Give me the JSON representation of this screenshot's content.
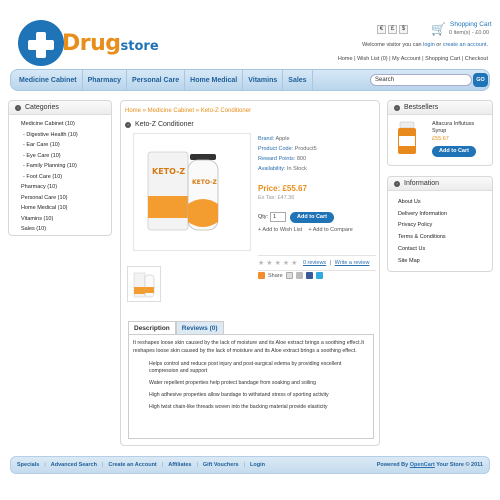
{
  "brand": {
    "drug": "Drug",
    "store": "store"
  },
  "currency": {
    "buttons": [
      "€",
      "£",
      "$"
    ]
  },
  "cart": {
    "title": "Shopping Cart",
    "summary": "0 item(s) - £0.00"
  },
  "welcome": {
    "prefix": "Welcome visitor you can ",
    "login": "login",
    "middle": " or ",
    "create": "create an account",
    "suffix": "."
  },
  "toplinks": [
    "Home",
    "Wish List (0)",
    "My Account",
    "Shopping Cart",
    "Checkout"
  ],
  "nav": [
    "Medicine Cabinet",
    "Pharmacy",
    "Personal Care",
    "Home Medical",
    "Vitamins",
    "Sales"
  ],
  "search": {
    "value": "Search",
    "go": "GO"
  },
  "categories": {
    "title": "Categories",
    "items": [
      {
        "label": "Medicine Cabinet (10)",
        "sub": false
      },
      {
        "label": "- Digestive Health (10)",
        "sub": true
      },
      {
        "label": "- Ear Care (10)",
        "sub": true
      },
      {
        "label": "- Eye Care (10)",
        "sub": true
      },
      {
        "label": "- Family Planning (10)",
        "sub": true
      },
      {
        "label": "- Foot Care (10)",
        "sub": true
      },
      {
        "label": "Pharmacy (10)",
        "sub": false
      },
      {
        "label": "Personal Care (10)",
        "sub": false
      },
      {
        "label": "Home Medical (10)",
        "sub": false
      },
      {
        "label": "Vitamins (10)",
        "sub": false
      },
      {
        "label": "Sales (10)",
        "sub": false
      }
    ]
  },
  "product": {
    "breadcrumb": "Home » Medicine Cabinet » Keto-Z Conditioner",
    "title": "Keto-Z Conditioner",
    "image_brand": "KETO-Z",
    "brand_label": "Brand:",
    "brand": "Apple",
    "code_label": "Product Code:",
    "code": "Product5",
    "points_label": "Reward Points:",
    "points": "800",
    "avail_label": "Availability:",
    "availability": "In Stock",
    "price": "Price: £55.67",
    "ex_tax": "Ex Tax: £47.36",
    "qty_label": "Qty:",
    "qty": "1",
    "add_to_cart": "Add to Cart",
    "wish": "+ Add to Wish List",
    "compare": "+ Add to Compare",
    "reviews_count": "0 reviews",
    "write_review": "Write a review",
    "share": "Share"
  },
  "tabs": {
    "description": "Description",
    "reviews": "Reviews (0)"
  },
  "description": {
    "intro": "It reshapes loose skin caused by the lack of moisture and its Aloe extract brings a soothing effect.It reshapes loose skin caused by the lack of moisture and its Aloe extract brings a soothing effect.",
    "bullets": [
      "Helps control and reduce post injury and post-surgical edema by providing excellent compression and support",
      "Water repellent properties help protect bandage from soaking and soiling",
      "High adhesive properties allow bandage to withstand stress of sporting activity",
      "High twist chain-like threads woven into the backing material provide elasticity"
    ]
  },
  "bestsellers": {
    "title": "Bestsellers",
    "name": "Altacura Influtuss Syrup",
    "price": "£55.67",
    "button": "Add to Cart"
  },
  "information": {
    "title": "Information",
    "items": [
      "About Us",
      "Delivery Information",
      "Privacy Policy",
      "Terms & Conditions",
      "Contact Us",
      "Site Map"
    ]
  },
  "footer": {
    "links": [
      "Specials",
      "Advanced Search",
      "Create an Account",
      "Affiliates",
      "Gift Vouchers",
      "Login"
    ],
    "powered_prefix": "Powered By ",
    "powered_link": "OpenCart",
    "powered_suffix": " Your Store © 2011"
  },
  "colors": {
    "accent": "#1f73b7",
    "orange": "#e88e1a"
  }
}
